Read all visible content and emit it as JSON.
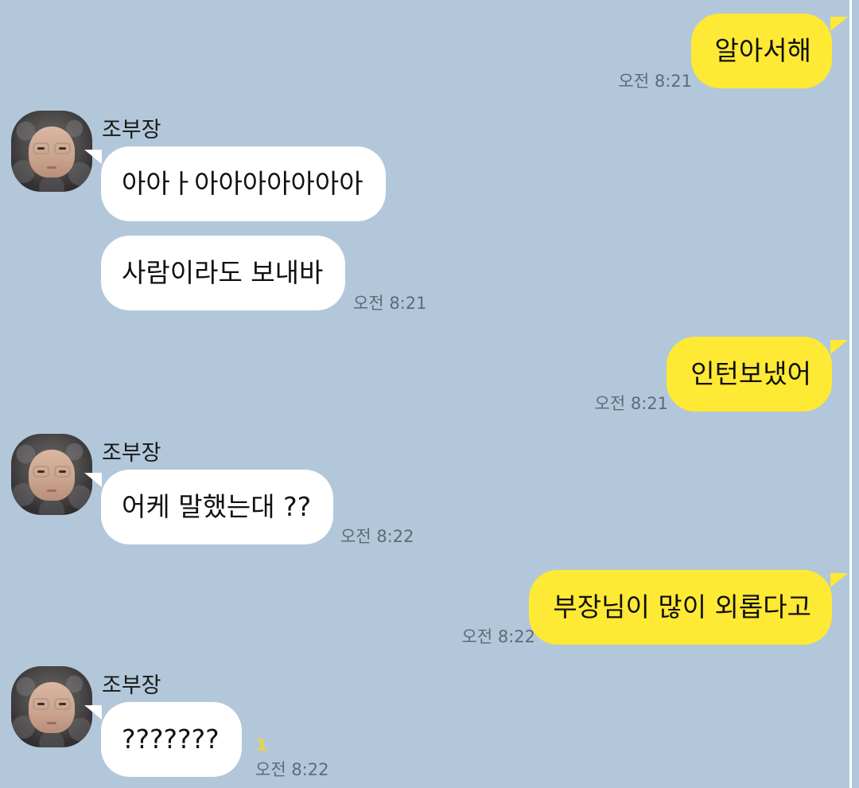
{
  "contact": {
    "name": "조부장",
    "avatar_icon": "profile-photo-icon"
  },
  "colors": {
    "background": "#b2c7da",
    "outgoing_bubble": "#fee934",
    "incoming_bubble": "#ffffff",
    "timestamp": "#5f6b76",
    "unread_badge": "#f1d533"
  },
  "messages": [
    {
      "direction": "outgoing",
      "text": "알아서해",
      "time": "오전 8:21"
    },
    {
      "direction": "incoming",
      "sender": "조부장",
      "text": "아아ㅏ아아아아아아아",
      "time": ""
    },
    {
      "direction": "incoming",
      "text": "사람이라도 보내바",
      "time": "오전 8:21"
    },
    {
      "direction": "outgoing",
      "text": "인턴보냈어",
      "time": "오전 8:21"
    },
    {
      "direction": "incoming",
      "sender": "조부장",
      "text": "어케 말했는대 ??",
      "time": "오전 8:22"
    },
    {
      "direction": "outgoing",
      "text": "부장님이 많이 외롭다고",
      "time": "오전 8:22"
    },
    {
      "direction": "incoming",
      "sender": "조부장",
      "text": "???????",
      "time": "오전 8:22",
      "unread": "1"
    }
  ]
}
